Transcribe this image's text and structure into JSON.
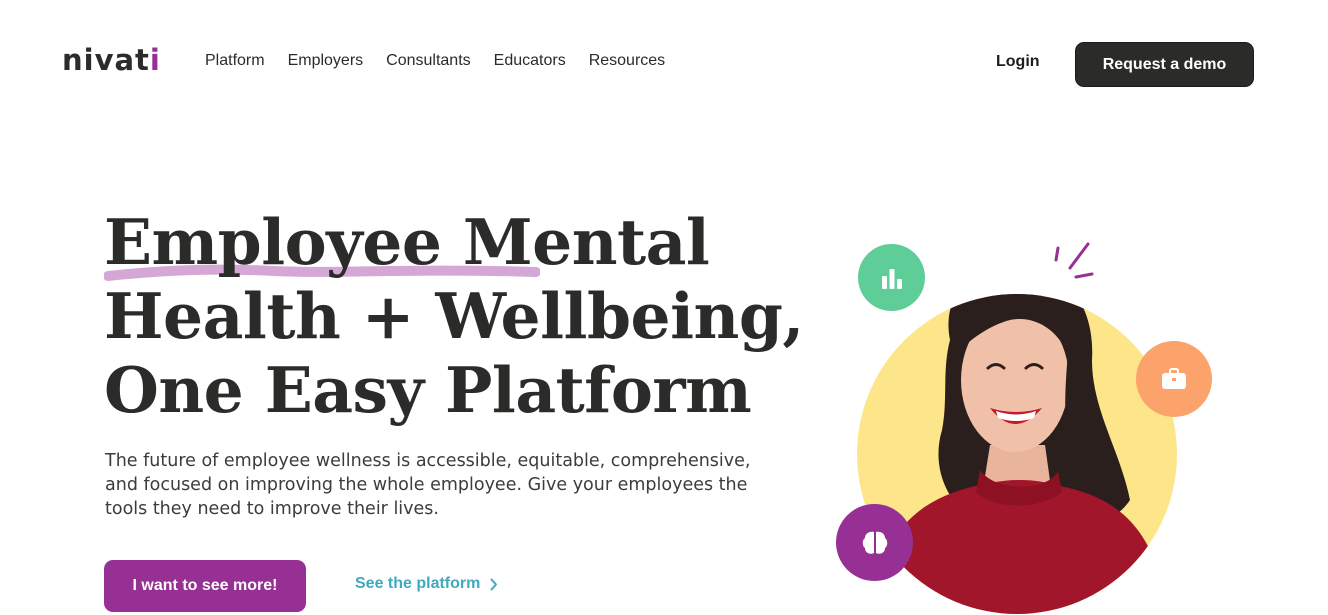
{
  "header": {
    "logo_main": "nivat",
    "logo_end": "i",
    "nav": [
      "Platform",
      "Employers",
      "Consultants",
      "Educators",
      "Resources"
    ],
    "login_label": "Login",
    "demo_label": "Request a demo"
  },
  "hero": {
    "title_lines": [
      "Employee Mental",
      "Health + Wellbeing,",
      "One Easy Platform"
    ],
    "description": "The future of employee wellness is accessible, equitable, comprehensive, and focused on improving the whole employee. Give your employees the tools they need to improve their lives.",
    "primary_cta": "I want to see more!",
    "secondary_cta": "See the platform"
  },
  "colors": {
    "brand_purple": "#963094",
    "accent_teal": "#3fa9bf",
    "highlight_lilac": "#d5a7d6",
    "dark": "#2b2b29",
    "circle_yellow": "#fde68a",
    "bubble_green": "#5fcd97",
    "bubble_orange": "#fca26b"
  },
  "icons": {
    "chart_bubble": "bar-chart-icon",
    "briefcase_bubble": "briefcase-icon",
    "brain_bubble": "brain-icon",
    "link_arrow": "chevron-right-icon"
  }
}
